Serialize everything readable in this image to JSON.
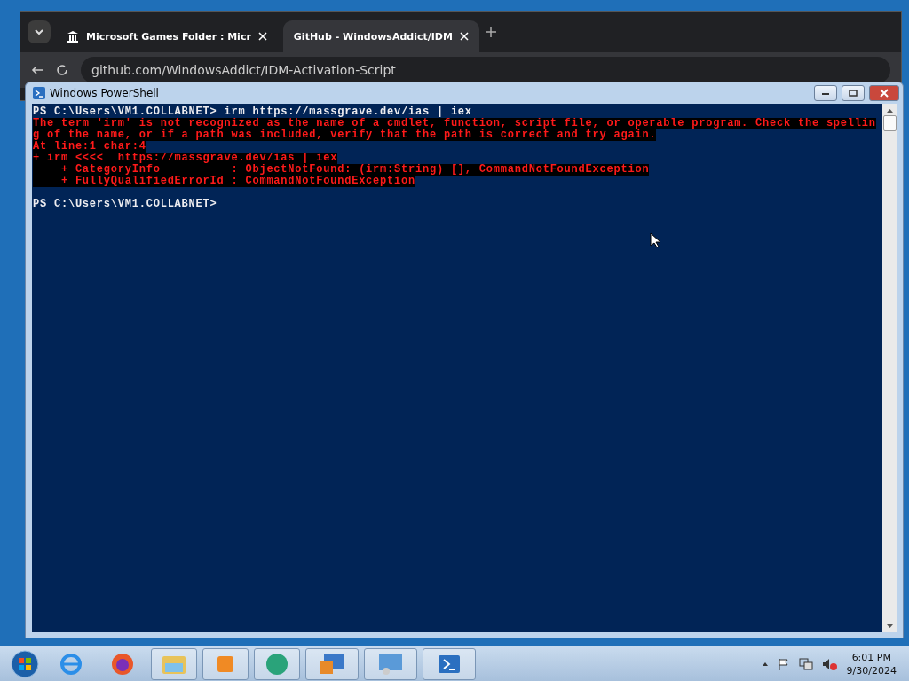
{
  "browser": {
    "tabs": [
      {
        "label": "Microsoft Games Folder : Micr",
        "selected": false
      },
      {
        "label": "GitHub - WindowsAddict/IDM",
        "selected": true
      }
    ],
    "address": "github.com/WindowsAddict/IDM-Activation-Script"
  },
  "console": {
    "title": "Windows PowerShell",
    "lines": [
      {
        "kind": "normal",
        "text": "PS C:\\Users\\VM1.COLLABNET> irm https://massgrave.dev/ias | iex"
      },
      {
        "kind": "error",
        "text": "The term 'irm' is not recognized as the name of a cmdlet, function, script file, or operable program. Check the spellin"
      },
      {
        "kind": "error",
        "text": "g of the name, or if a path was included, verify that the path is correct and try again."
      },
      {
        "kind": "error",
        "text": "At line:1 char:4"
      },
      {
        "kind": "error",
        "text": "+ irm <<<<  https://massgrave.dev/ias | iex"
      },
      {
        "kind": "error",
        "text": "    + CategoryInfo          : ObjectNotFound: (irm:String) [], CommandNotFoundException"
      },
      {
        "kind": "error",
        "text": "    + FullyQualifiedErrorId : CommandNotFoundException"
      },
      {
        "kind": "blank"
      },
      {
        "kind": "normal",
        "text": "PS C:\\Users\\VM1.COLLABNET>"
      }
    ]
  },
  "taskbar": {
    "time": "6:01 PM",
    "date": "9/30/2024"
  }
}
